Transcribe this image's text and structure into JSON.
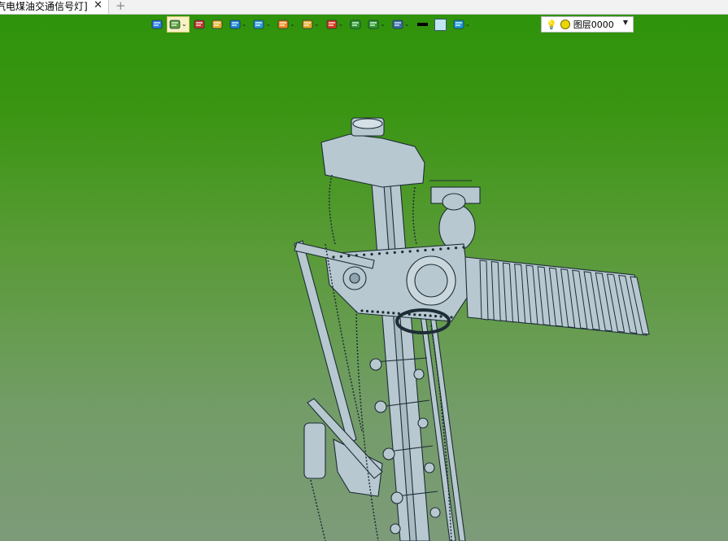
{
  "tab": {
    "title": "汽电煤油交通信号灯]",
    "close": "✕",
    "add": "+"
  },
  "toolbar": {
    "buttons": [
      {
        "name": "exit-icon",
        "color": "#2a7de1"
      },
      {
        "name": "render-mode-icon",
        "color": "#5aa33a",
        "active": true,
        "dropdown": true
      },
      {
        "name": "pen-icon",
        "color": "#c0392b"
      },
      {
        "name": "shaded-box-icon",
        "color": "#e2b22a"
      },
      {
        "name": "cube-icon",
        "color": "#1e88d6",
        "dropdown": true
      },
      {
        "name": "view-cube-icon",
        "color": "#2a9ad6",
        "dropdown": true
      },
      {
        "name": "section-icon",
        "color": "#f08a1c",
        "dropdown": true
      },
      {
        "name": "zoom-icon",
        "color": "#e5a623",
        "dropdown": true
      },
      {
        "name": "axis-icon",
        "color": "#d9381e",
        "dropdown": true
      },
      {
        "name": "fit-view-icon",
        "color": "#2e9a2e"
      },
      {
        "name": "ruler-icon",
        "color": "#2e9a2e",
        "dropdown": true
      },
      {
        "name": "display-icon",
        "color": "#3a6ea8",
        "dropdown": true
      },
      {
        "name": "line-style-icon",
        "color": "#000000"
      },
      {
        "name": "color-swatch-icon",
        "color": "#bfe6f2"
      },
      {
        "name": "layers-icon",
        "color": "#1e9ad6",
        "dropdown": true
      }
    ]
  },
  "layer": {
    "name": "图层0000",
    "bulb": "💡",
    "dot_color": "#e8d800"
  },
  "colors": {
    "viewport_top": "#2f930b",
    "viewport_bottom": "#7d9b79",
    "model_fill": "#b7c8d0",
    "model_stroke": "#1d2d36"
  }
}
